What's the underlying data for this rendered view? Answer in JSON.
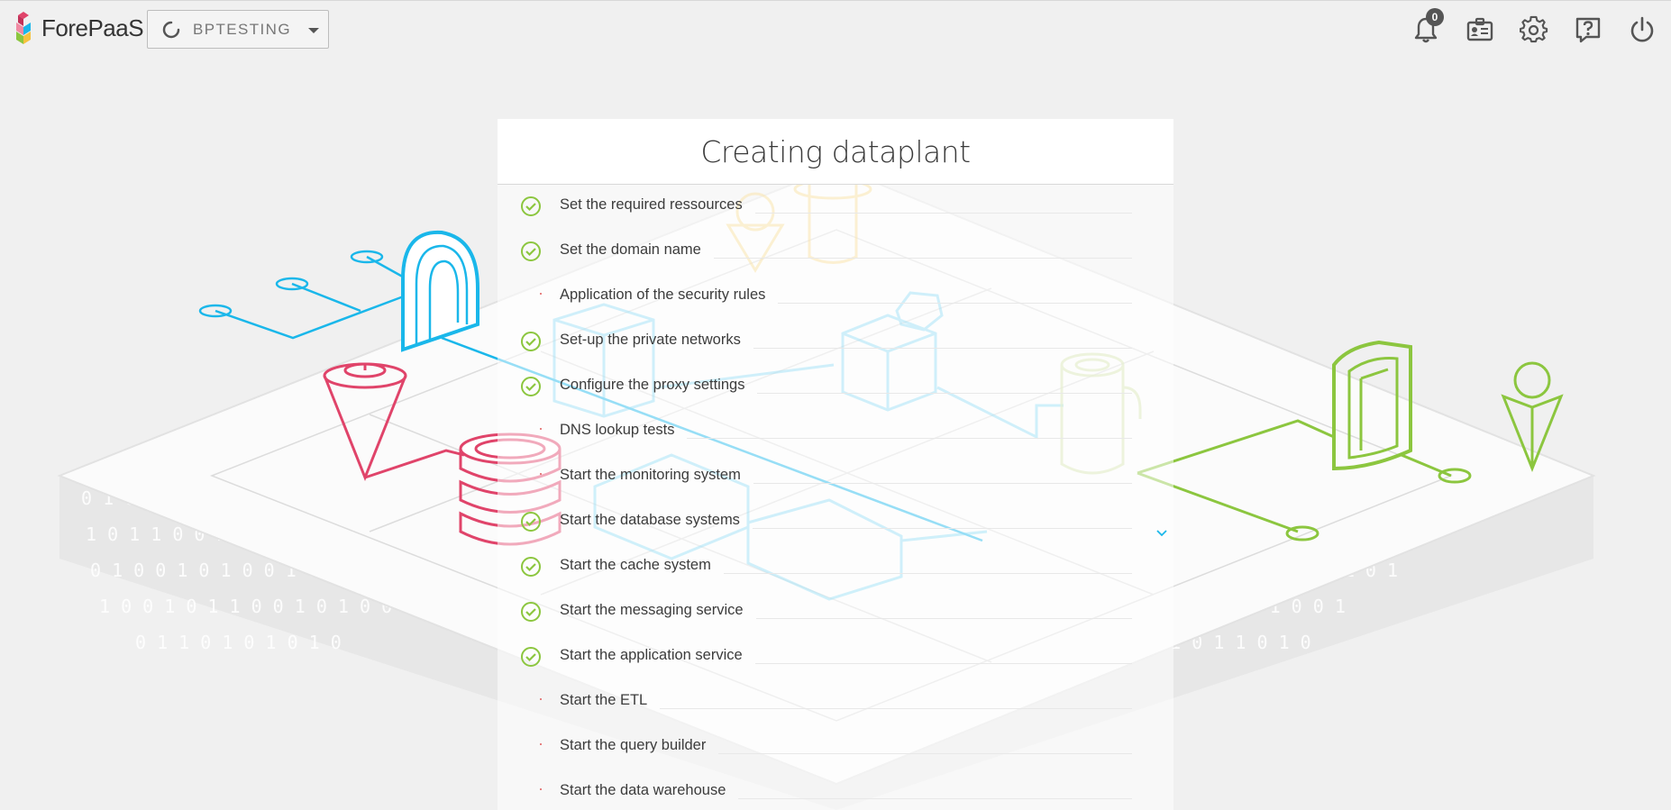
{
  "header": {
    "brand": "ForePaaS",
    "project": {
      "name": "BPTESTING",
      "status_icon": "loading-circle-icon"
    },
    "notifications": {
      "count": "0",
      "icon": "bell-icon"
    },
    "icons": [
      "bell-icon",
      "id-card-icon",
      "gear-icon",
      "help-icon",
      "power-icon"
    ]
  },
  "panel": {
    "title": "Creating dataplant",
    "steps": [
      {
        "label": "Set the required ressources",
        "status": "done"
      },
      {
        "label": "Set the domain name",
        "status": "done"
      },
      {
        "label": "Application of the security rules",
        "status": "pending"
      },
      {
        "label": "Set-up the private networks",
        "status": "done"
      },
      {
        "label": "Configure the proxy settings",
        "status": "done"
      },
      {
        "label": "DNS lookup tests",
        "status": "pending"
      },
      {
        "label": "Start the monitoring system",
        "status": "pending"
      },
      {
        "label": "Start the database systems",
        "status": "done"
      },
      {
        "label": "Start the cache system",
        "status": "done"
      },
      {
        "label": "Start the messaging service",
        "status": "done"
      },
      {
        "label": "Start the application service",
        "status": "done"
      },
      {
        "label": "Start the ETL",
        "status": "pending"
      },
      {
        "label": "Start the query builder",
        "status": "pending"
      },
      {
        "label": "Start the data warehouse",
        "status": "pending"
      }
    ]
  },
  "colors": {
    "done_green": "#8cc63f",
    "pending_red": "#e05a5a",
    "accent_blue": "#1ab7ea",
    "accent_pink": "#e0446a",
    "accent_yellow": "#f5c23e"
  }
}
